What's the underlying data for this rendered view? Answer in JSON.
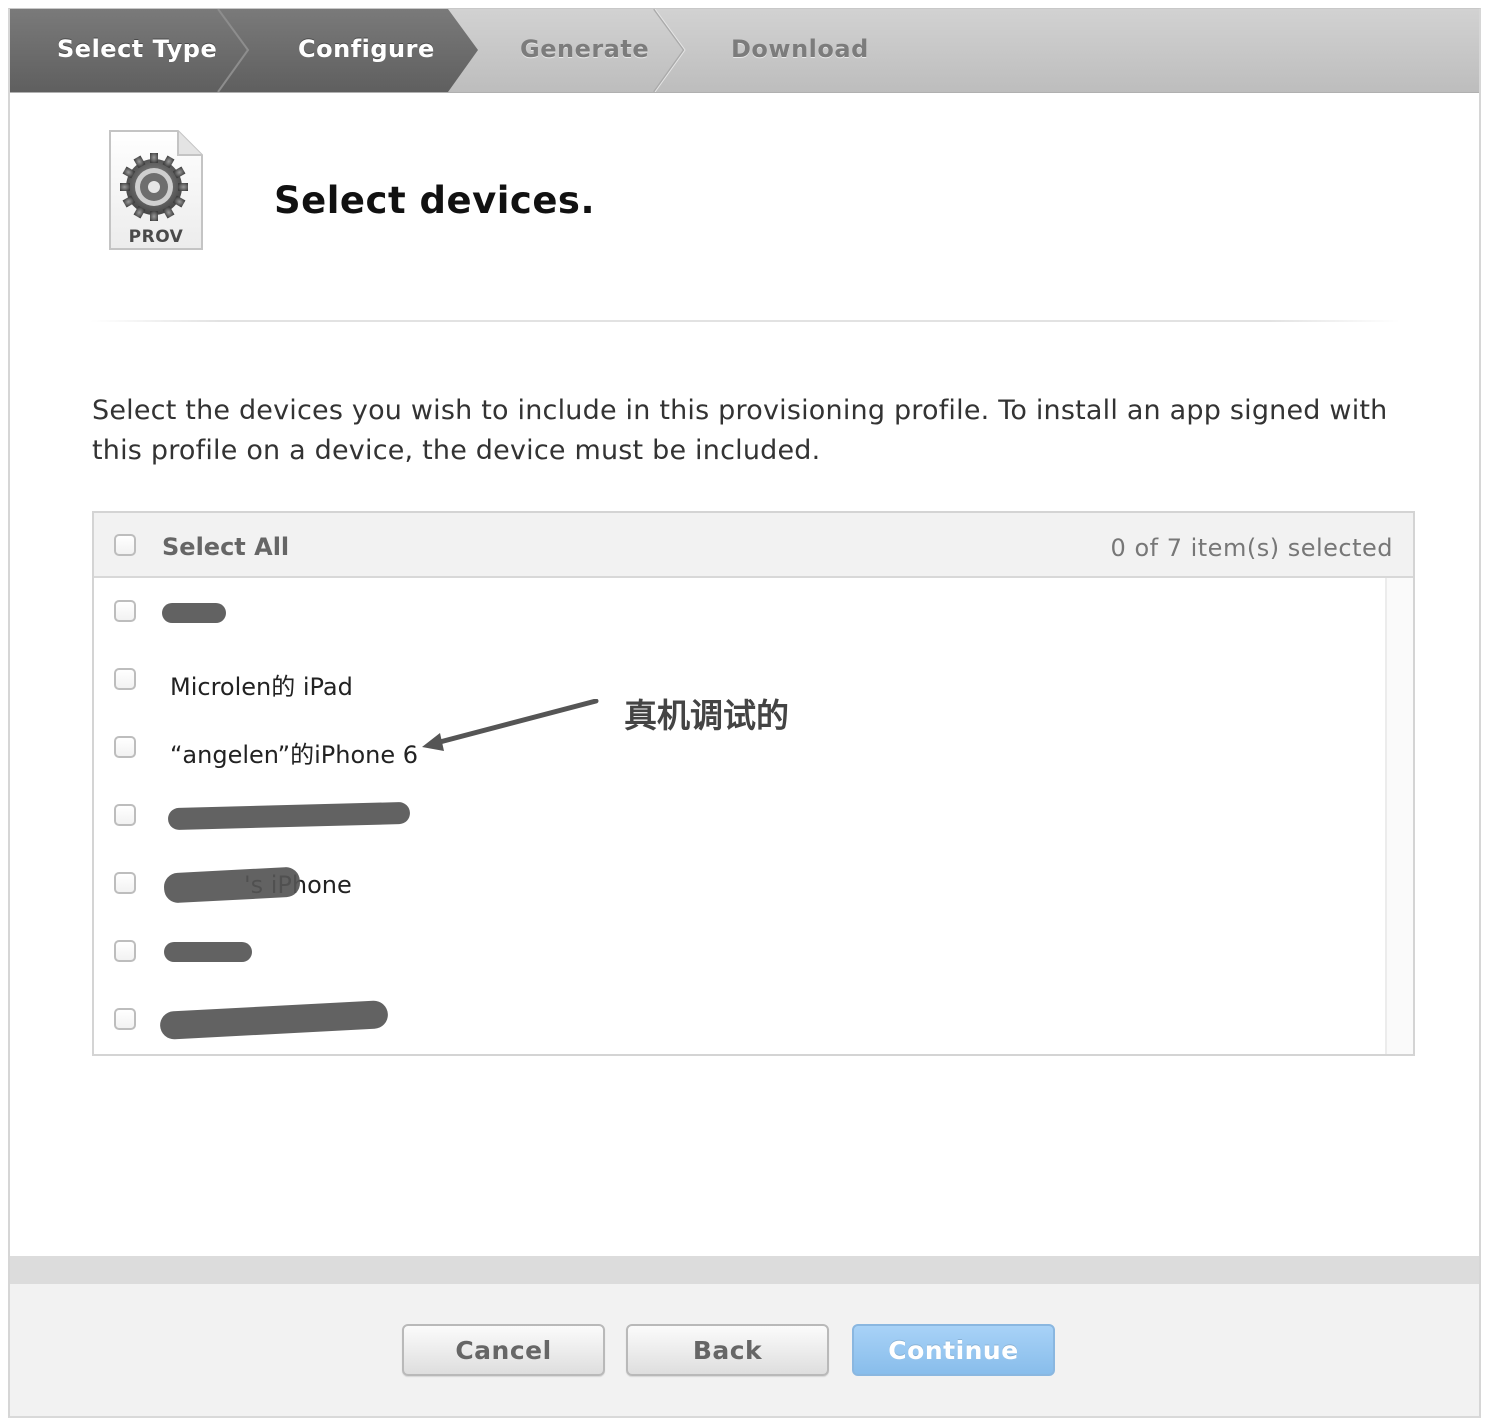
{
  "steps": [
    {
      "label": "Select Type",
      "state": "complete"
    },
    {
      "label": "Configure",
      "state": "current"
    },
    {
      "label": "Generate",
      "state": "upcoming"
    },
    {
      "label": "Download",
      "state": "upcoming"
    }
  ],
  "header": {
    "icon_label": "PROV",
    "icon_name": "provisioning-profile-gear-icon",
    "title": "Select devices."
  },
  "description": "Select the devices you wish to include in this provisioning profile. To install an app signed with this profile on a device, the device must be included.",
  "device_list": {
    "select_all_label": "Select All",
    "select_all_checked": false,
    "selection_count": "0 of 7 item(s) selected",
    "devices": [
      {
        "name": "",
        "checked": false,
        "redacted": true
      },
      {
        "name": "Microlen的 iPad",
        "checked": false,
        "redacted": false
      },
      {
        "name": "“angelen”的iPhone 6",
        "checked": false,
        "redacted": false
      },
      {
        "name": "",
        "checked": false,
        "redacted": true
      },
      {
        "name": "'s iPhone",
        "checked": false,
        "redacted": true
      },
      {
        "name": "",
        "checked": false,
        "redacted": true
      },
      {
        "name": "",
        "checked": false,
        "redacted": true
      }
    ]
  },
  "annotation": {
    "text": "真机调试的",
    "color": "#555555"
  },
  "buttons": {
    "cancel": "Cancel",
    "back": "Back",
    "continue": "Continue"
  },
  "colors": {
    "active_step": "#6e6e6e",
    "inactive_step": "#c7c7c7",
    "continue_button": "#9ccaf3"
  }
}
